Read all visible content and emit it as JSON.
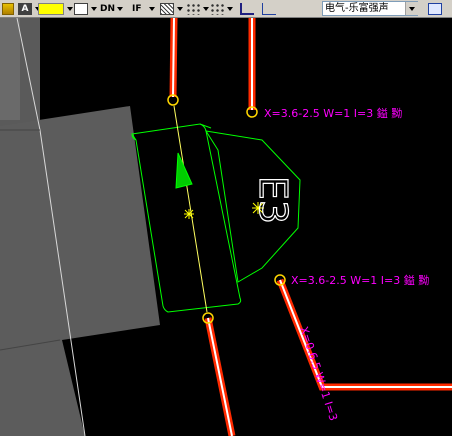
{
  "toolbar": {
    "color_swatch": "#ffff00",
    "layer_name": "电气-乐富强声",
    "items": [
      {
        "icon": "layer-state-icon"
      },
      {
        "icon": "text-style-icon",
        "label": "A"
      },
      {
        "icon": "color-picker-icon"
      },
      {
        "icon": "line-type-icon"
      },
      {
        "icon": "linetype-dn-icon",
        "label": "DN"
      },
      {
        "icon": "lineweight-icon",
        "label": "IF"
      },
      {
        "icon": "hatch-icon"
      },
      {
        "icon": "snap-icon"
      },
      {
        "icon": "layer-icon"
      },
      {
        "icon": "match-icon"
      }
    ]
  },
  "drawing": {
    "pipe_label_1": "X=3.6-2.5 W=1 I=3 鎰 黝",
    "pipe_label_2": "X=3.6-2.5 W=1 I=3 鎰 黝",
    "vertical_label": "X=0.6.5 W=1 I=3",
    "room_label": "E3",
    "colors": {
      "pipe_outer": "#ff2a00",
      "pipe_inner": "#ffffff",
      "equipment": "#00ff00",
      "annotation": "#ff00ff",
      "marker": "#ffff00",
      "wall": "#5a5a5a"
    }
  }
}
